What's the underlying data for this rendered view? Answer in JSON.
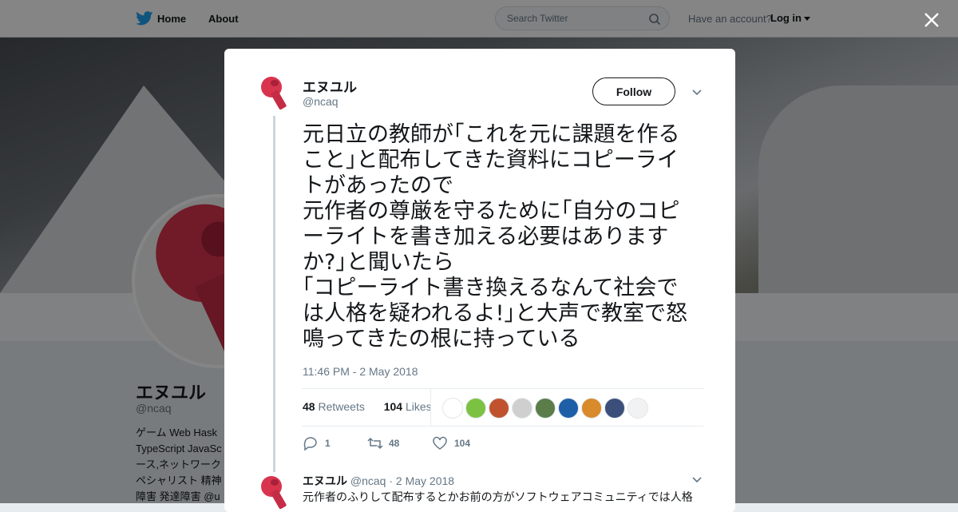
{
  "nav": {
    "home_label": "Home",
    "about_label": "About",
    "search_placeholder": "Search Twitter",
    "have_account": "Have an account?",
    "login_label": "Log in"
  },
  "profile": {
    "name": "エヌユル",
    "handle": "@ncaq",
    "bio": "ゲーム Web Hask\nTypeScript JavaSc\nース,ネットワーク\nペシャリスト 精神\n障害 発達障害 @u"
  },
  "tweet": {
    "name": "エヌユル",
    "handle": "@ncaq",
    "follow_label": "Follow",
    "text": "元日立の教師が｢これを元に課題を作る\nこと｣と配布してきた資料にコピーライ\nトがあったので\n元作者の尊厳を守るために｢自分のコピ\nーライトを書き加える必要はあります\nか?｣と聞いたら\n｢コピーライト書き換えるなんて社会で\nは人格を疑われるよ!｣と大声で教室で怒\n鳴ってきたの根に持っている",
    "timestamp": "11:46 PM - 2 May 2018",
    "retweets_count": "48",
    "retweets_label": "Retweets",
    "likes_count": "104",
    "likes_label": "Likes",
    "actions": {
      "reply_count": "1",
      "retweet_count": "48",
      "like_count": "104"
    }
  },
  "likers": [
    {
      "icon": "liker-avatar",
      "color": "#ffffff"
    },
    {
      "icon": "liker-avatar",
      "color": "#7cc242"
    },
    {
      "icon": "liker-avatar",
      "color": "#c0532e"
    },
    {
      "icon": "liker-avatar",
      "color": "#cfcfcf"
    },
    {
      "icon": "liker-avatar",
      "color": "#5a7d4a"
    },
    {
      "icon": "liker-avatar",
      "color": "#1f5fa8"
    },
    {
      "icon": "liker-avatar",
      "color": "#d98a2b"
    },
    {
      "icon": "liker-avatar",
      "color": "#3b4f7a"
    },
    {
      "icon": "liker-avatar",
      "color": "#f2f2f2"
    }
  ],
  "reply": {
    "name": "エヌユル",
    "handle": "@ncaq",
    "separator": "·",
    "date": "2 May 2018",
    "text": "元作者のふりして配布するとかお前の方がソフトウェアコミュニティでは人格"
  },
  "colors": {
    "brand": "#1da1f2",
    "avatar_red": "#d8344e"
  }
}
